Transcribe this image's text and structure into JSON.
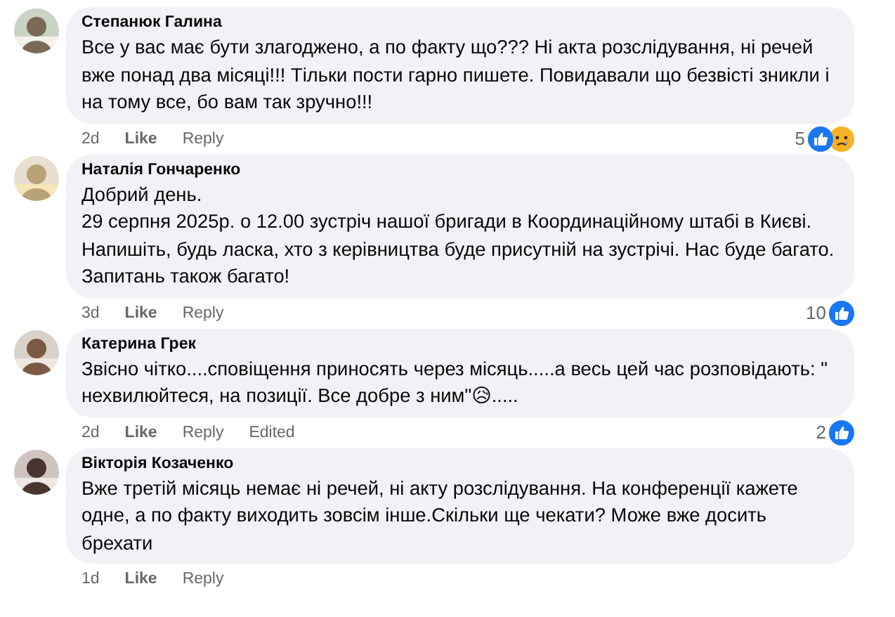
{
  "comments": [
    {
      "author": "Степанюк Галина",
      "avatar": {
        "kind": "picture"
      },
      "paragraphs": [
        "Все у вас має бути злагоджено, а по факту що??? Ні акта розслідування, ні речей вже понад два місяці!!! Тільки пости гарно пишете. Повидавали що безвісті зникли і на тому все, бо вам так зручно!!!"
      ],
      "time": "2d",
      "like": "Like",
      "reply": "Reply",
      "reaction_count": "5",
      "reactions": [
        {
          "kind": "like"
        },
        {
          "kind": "sad"
        }
      ]
    },
    {
      "author": "Наталія Гончаренко",
      "avatar": {
        "kind": "picture"
      },
      "paragraphs": [
        "Добрий день.",
        "29 серпня 2025р. о 12.00 зустріч нашої бригади в Координаційному штабі в Києві.",
        "Напишіть, будь ласка, хто з керівництва буде присутній на зустрічі. Нас буде багато.",
        "Запитань також багато!"
      ],
      "time": "3d",
      "like": "Like",
      "reply": "Reply",
      "reaction_count": "10",
      "reactions": [
        {
          "kind": "like"
        }
      ]
    },
    {
      "author": "Катерина Грек",
      "avatar": {
        "kind": "picture"
      },
      "paragraphs": [
        "Звісно чітко....сповіщення приносять через місяць.....а весь цей час розповідають: \" нехвилюйтеся, на позиції. Все добре з ним\"😥....."
      ],
      "time": "2d",
      "like": "Like",
      "reply": "Reply",
      "edited": "Edited",
      "reaction_count": "2",
      "reactions": [
        {
          "kind": "like"
        }
      ]
    },
    {
      "author": "Вікторія Козаченко",
      "avatar": {
        "kind": "picture"
      },
      "paragraphs": [
        "Вже третій місяць немає ні речей, ні акту розслідування. На конференції кажете одне, а по факту виходить зовсім інше.Скільки ще чекати? Може вже досить брехати"
      ],
      "time": "1d",
      "like": "Like",
      "reply": "Reply"
    }
  ]
}
